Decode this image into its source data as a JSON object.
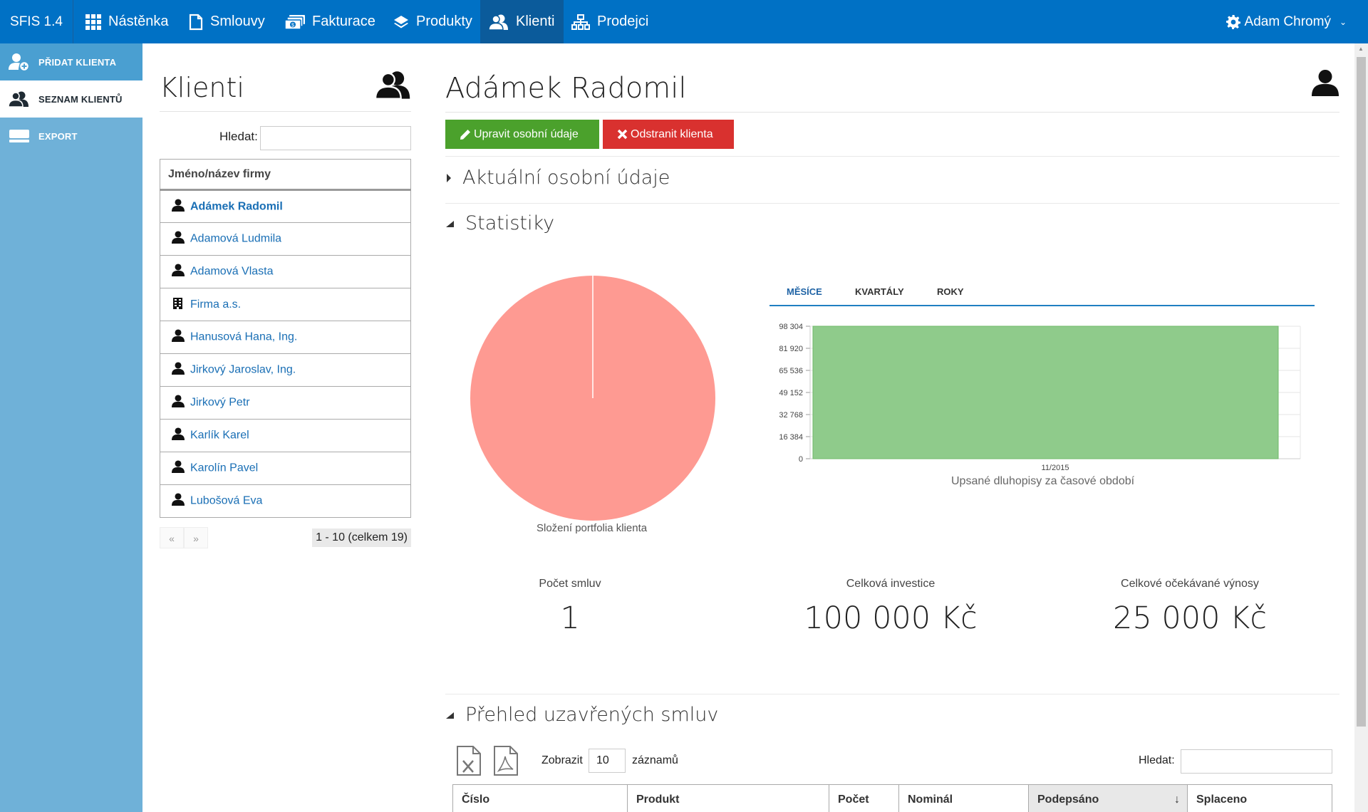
{
  "app": {
    "brand": "SFIS 1.4"
  },
  "nav": [
    {
      "label": "Nástěnka",
      "icon": "grid-icon"
    },
    {
      "label": "Smlouvy",
      "icon": "document-icon"
    },
    {
      "label": "Fakturace",
      "icon": "money-icon"
    },
    {
      "label": "Produkty",
      "icon": "layers-icon"
    },
    {
      "label": "Klienti",
      "icon": "users-icon",
      "active": true
    },
    {
      "label": "Prodejci",
      "icon": "hierarchy-icon"
    }
  ],
  "user": {
    "name": "Adam Chromý"
  },
  "sidebar": [
    {
      "label": "PŘIDAT KLIENTA",
      "icon": "add-user-icon"
    },
    {
      "label": "SEZNAM KLIENTŮ",
      "icon": "users-icon",
      "selected": true
    },
    {
      "label": "EXPORT",
      "icon": "export-icon"
    }
  ],
  "clientList": {
    "title": "Klienti",
    "searchLabel": "Hledat:",
    "columnHeader": "Jméno/název firmy",
    "rows": [
      {
        "name": "Adámek Radomil",
        "type": "person",
        "active": true
      },
      {
        "name": "Adamová Ludmila",
        "type": "person"
      },
      {
        "name": "Adamová Vlasta",
        "type": "person"
      },
      {
        "name": "Firma a.s.",
        "type": "company"
      },
      {
        "name": "Hanusová Hana, Ing.",
        "type": "person"
      },
      {
        "name": "Jirkový Jaroslav, Ing.",
        "type": "person"
      },
      {
        "name": "Jirkový Petr",
        "type": "person"
      },
      {
        "name": "Karlík Karel",
        "type": "person"
      },
      {
        "name": "Karolín Pavel",
        "type": "person"
      },
      {
        "name": "Lubošová Eva",
        "type": "person"
      }
    ],
    "pager": {
      "prev": "«",
      "next": "»",
      "count": "1 - 10 (celkem 19)"
    }
  },
  "detail": {
    "name": "Adámek Radomil",
    "editButton": "Upravit osobní údaje",
    "deleteButton": "Odstranit klienta",
    "sectionPersonal": "Aktuální osobní údaje",
    "sectionStats": "Statistiky",
    "pieLabel": "Složení portfolia klienta",
    "tabs": [
      {
        "label": "MĚSÍCE",
        "active": true
      },
      {
        "label": "KVARTÁLY"
      },
      {
        "label": "ROKY"
      }
    ],
    "barTitle": "Upsané dluhopisy za časové období",
    "stats": [
      {
        "label": "Počet smluv",
        "value": "1"
      },
      {
        "label": "Celková investice",
        "value": "100 000 Kč"
      },
      {
        "label": "Celkové očekávané výnosy",
        "value": "25 000 Kč"
      }
    ],
    "sectionContracts": "Přehled uzavřených smluv",
    "showLabel": "Zobrazit",
    "showValue": "10",
    "showSuffix": "záznamů",
    "searchLabel": "Hledat:",
    "contractColumns": [
      "Číslo",
      "Produkt",
      "Počet",
      "Nominál",
      "Podepsáno",
      "Splaceno"
    ],
    "sortArrow": "↓"
  },
  "chart_data": [
    {
      "type": "pie",
      "title": "Složení portfolia klienta",
      "values": [
        100
      ],
      "colors": [
        "#fe9a92"
      ]
    },
    {
      "type": "bar",
      "title": "Upsané dluhopisy za časové období",
      "categories": [
        "11/2015"
      ],
      "values": [
        98304
      ],
      "ylim": [
        0,
        98304
      ],
      "yticks": [
        "0",
        "16 384",
        "32 768",
        "49 152",
        "65 536",
        "81 920",
        "98 304"
      ],
      "color": "#8fcb8b",
      "grid": true
    }
  ]
}
